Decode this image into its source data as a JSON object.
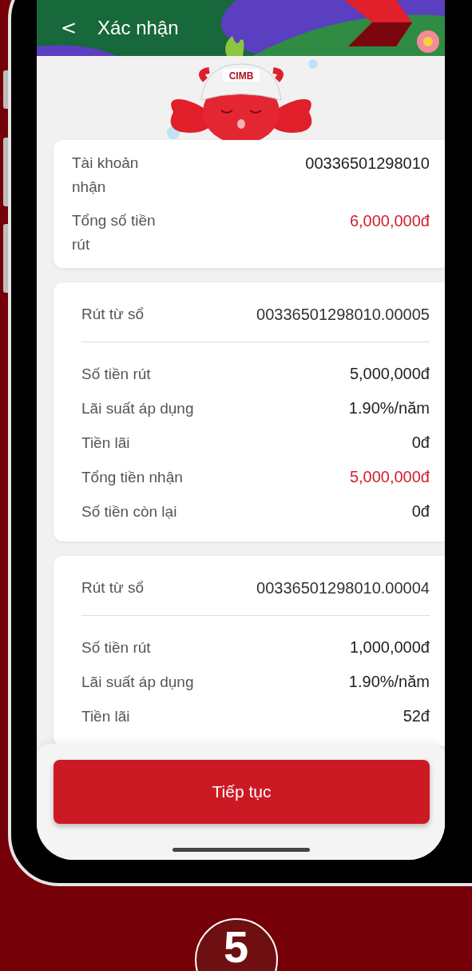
{
  "header": {
    "back_icon": "<",
    "title": "Xác nhận"
  },
  "mascot": {
    "cap_text": "CIMB"
  },
  "summary": [
    {
      "label": "Tài khoản nhận",
      "value": "00336501298010",
      "highlight": false
    },
    {
      "label": "Tổng số tiền rút",
      "value": "6,000,000đ",
      "highlight": true
    }
  ],
  "withdrawals": [
    {
      "source_label": "Rút từ sổ",
      "source_value": "00336501298010.00005",
      "rows": [
        {
          "label": "Số tiền rút",
          "value": "5,000,000đ",
          "highlight": false
        },
        {
          "label": "Lãi suất áp dụng",
          "value": "1.90%/năm",
          "highlight": false
        },
        {
          "label": "Tiền lãi",
          "value": "0đ",
          "highlight": false
        },
        {
          "label": "Tổng tiền nhận",
          "value": "5,000,000đ",
          "highlight": true
        },
        {
          "label": "Số tiền còn lại",
          "value": "0đ",
          "highlight": false
        }
      ]
    },
    {
      "source_label": "Rút từ sổ",
      "source_value": "00336501298010.00004",
      "rows": [
        {
          "label": "Số tiền rút",
          "value": "1,000,000đ",
          "highlight": false
        },
        {
          "label": "Lãi suất áp dụng",
          "value": "1.90%/năm",
          "highlight": false
        },
        {
          "label": "Tiền lãi",
          "value": "52đ",
          "highlight": false
        }
      ]
    }
  ],
  "button": {
    "label": "Tiếp tục"
  },
  "step": "5"
}
